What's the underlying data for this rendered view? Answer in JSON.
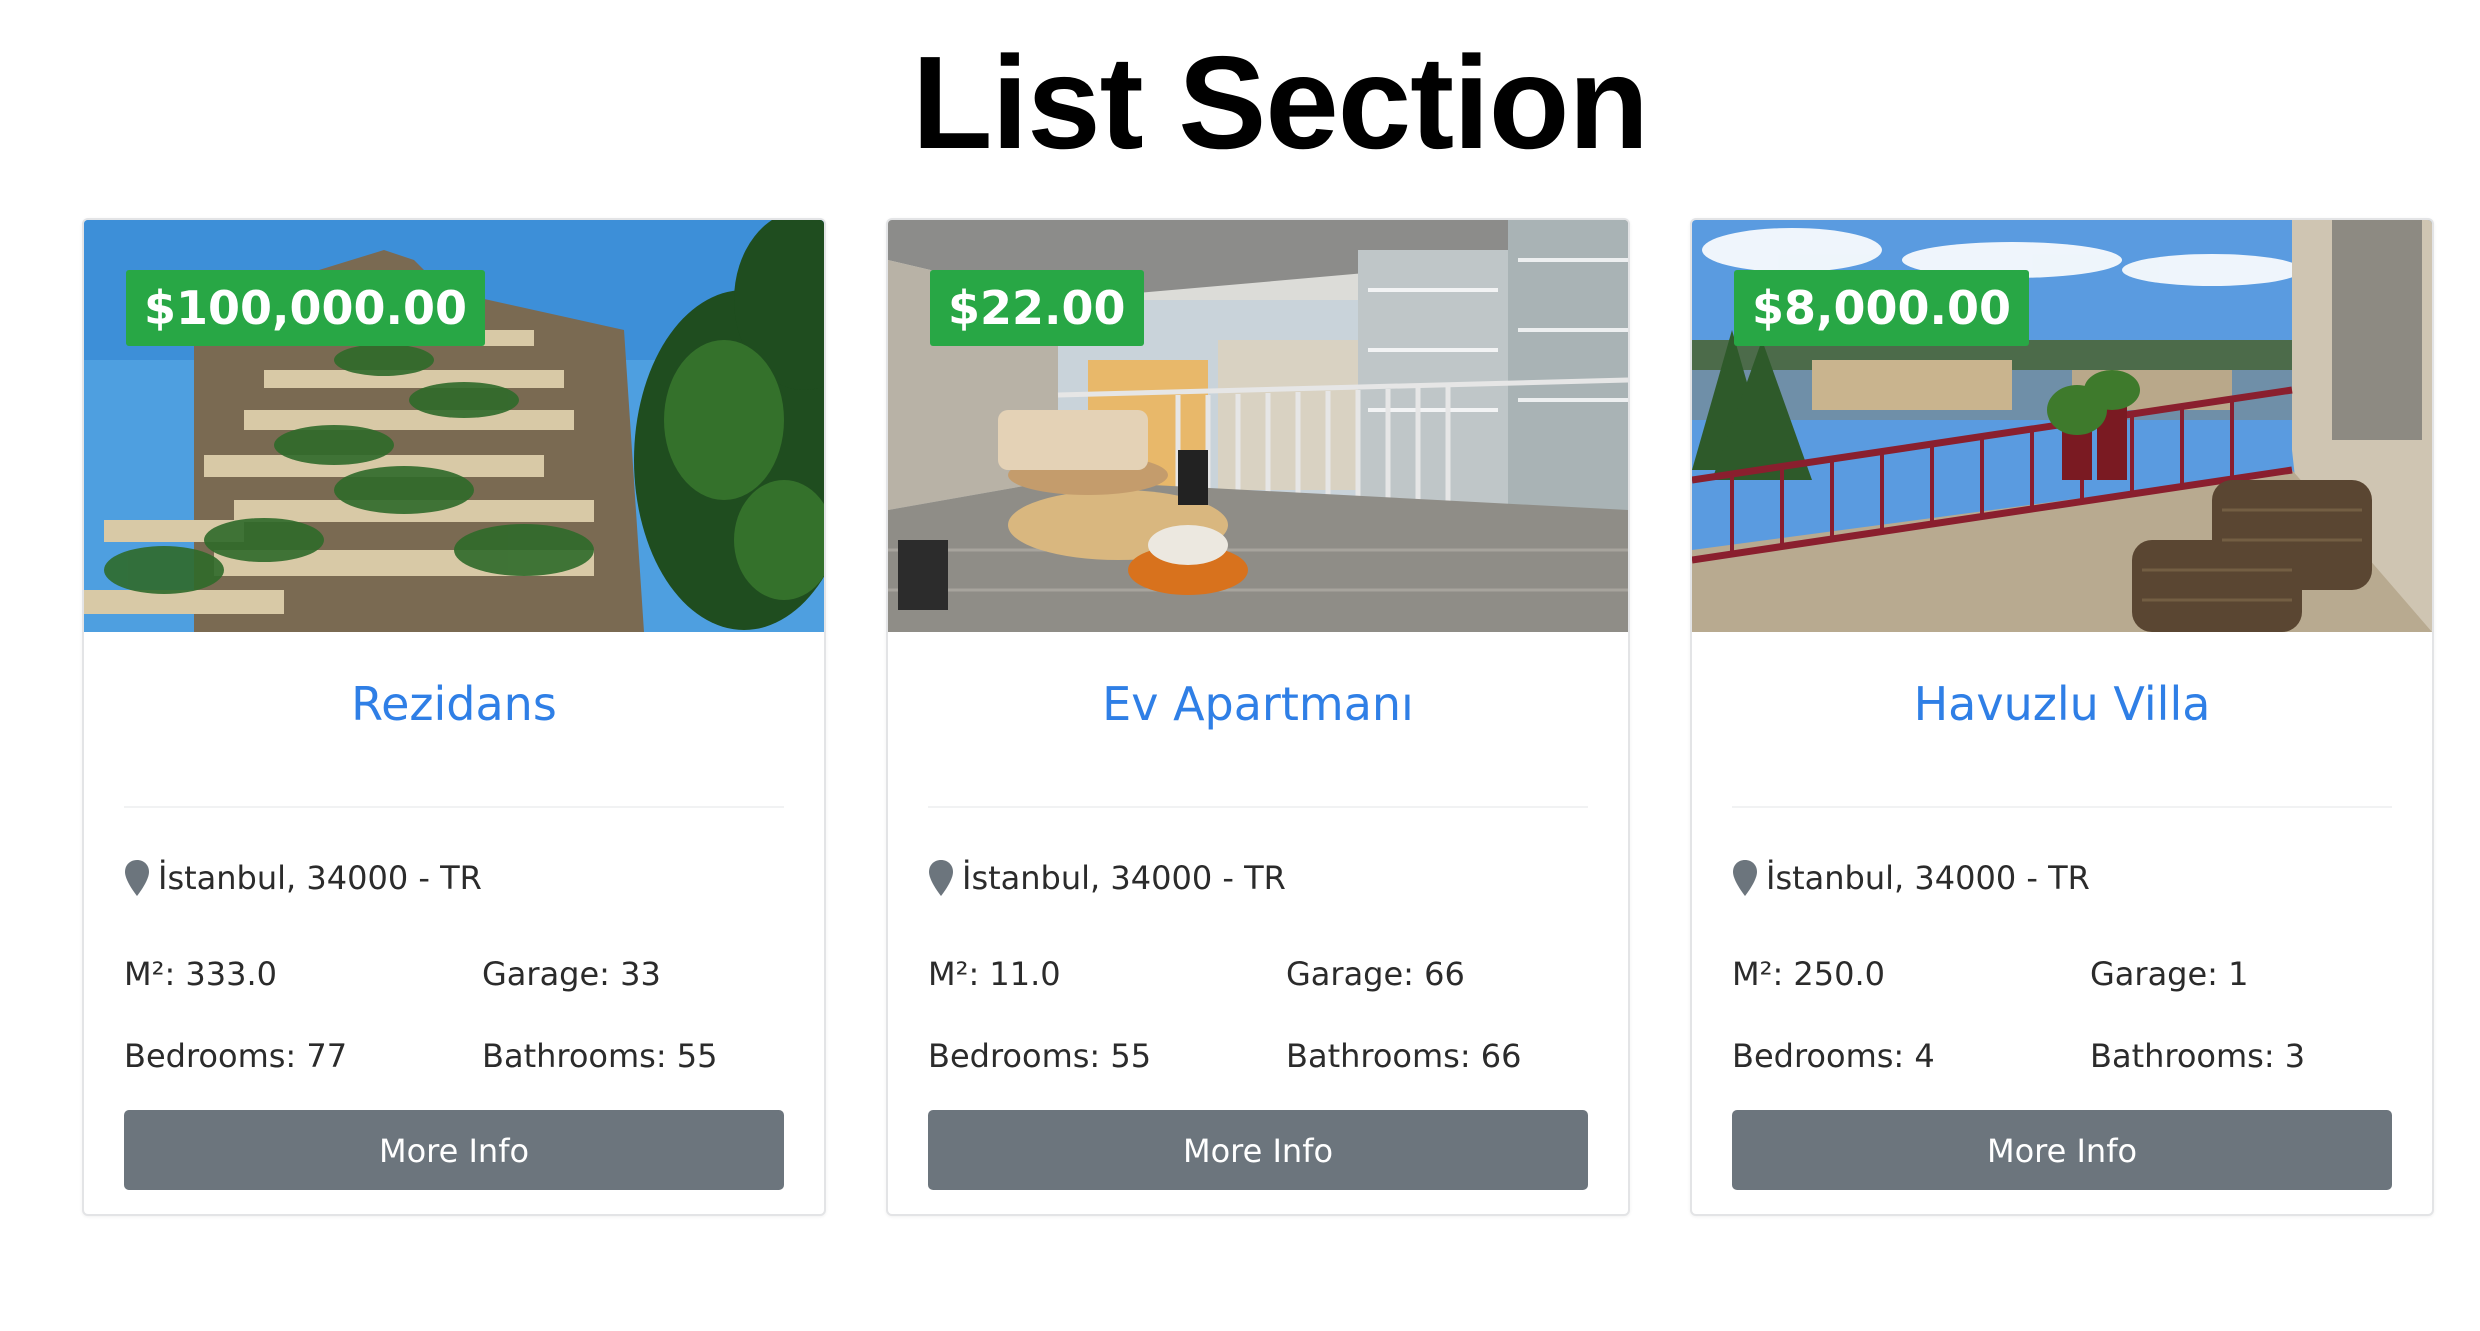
{
  "page": {
    "title": "List Section"
  },
  "listings": [
    {
      "price": "$100,000.00",
      "title": "Rezidans",
      "location": "İstanbul, 34000 - TR",
      "area": "M²: 333.0",
      "garage": "Garage: 33",
      "bedrooms": "Bedrooms: 77",
      "bathrooms": "Bathrooms: 55",
      "button": "More Info",
      "image_subject": "vertical-forest-tower-photo"
    },
    {
      "price": "$22.00",
      "title": "Ev Apartmanı",
      "location": "İstanbul, 34000 - TR",
      "area": "M²: 11.0",
      "garage": "Garage: 66",
      "bedrooms": "Bedrooms: 55",
      "bathrooms": "Bathrooms: 66",
      "button": "More Info",
      "image_subject": "glass-balcony-lounge-photo"
    },
    {
      "price": "$8,000.00",
      "title": "Havuzlu Villa",
      "location": "İstanbul, 34000 - TR",
      "area": "M²: 250.0",
      "garage": "Garage: 1",
      "bedrooms": "Bedrooms: 4",
      "bathrooms": "Bathrooms: 3",
      "button": "More Info",
      "image_subject": "terrace-balcony-view-photo"
    }
  ],
  "colors": {
    "price_badge": "#28a745",
    "title_link": "#2f7fe6",
    "button_bg": "#6c757d",
    "card_border": "#e3e4e6"
  },
  "icons": {
    "location": "map-pin-icon"
  }
}
